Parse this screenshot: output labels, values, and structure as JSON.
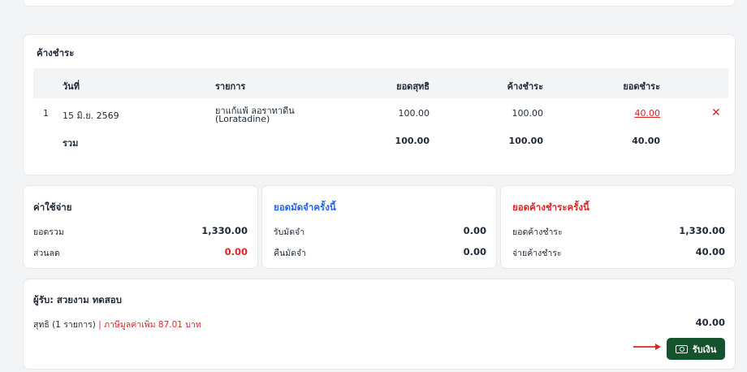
{
  "debt": {
    "title": "ค้างชำระ",
    "columns": [
      "วันที่",
      "รายการ",
      "ยอดสุทธิ",
      "ค้างชำระ",
      "ยอดชำระ"
    ],
    "rows": [
      {
        "index": "1",
        "date": "15 มิ.ย. 2569",
        "item_line1": "ยาแก้แพ้ ลอราทาดีน",
        "item_line2": "(Loratadine)",
        "net": "100.00",
        "outstanding": "100.00",
        "paid": "40.00"
      }
    ],
    "total": {
      "label": "รวม",
      "net": "100.00",
      "outstanding": "100.00",
      "paid": "40.00"
    }
  },
  "expenses": {
    "title": "ค่าใช้จ่าย",
    "rows": [
      {
        "label": "ยอดรวม",
        "value": "1,330.00"
      },
      {
        "label": "ส่วนลด",
        "value": "0.00"
      }
    ]
  },
  "deposit": {
    "title": "ยอดมัดจำครั้งนี้",
    "rows": [
      {
        "label": "รับมัดจำ",
        "value": "0.00"
      },
      {
        "label": "คืนมัดจำ",
        "value": "0.00"
      }
    ]
  },
  "outstanding_now": {
    "title": "ยอดค้างชำระครั้งนี้",
    "rows": [
      {
        "label": "ยอดค้างชำระ",
        "value": "1,330.00"
      },
      {
        "label": "จ่ายค้างชำระ",
        "value": "40.00"
      }
    ]
  },
  "receiver": {
    "title": "ผู้รับ: สวยงาม ทดสอบ",
    "net_label": "สุทธิ (1 รายการ)",
    "separator": "|",
    "vat_text": "ภาษีมูลค่าเพิ่ม 87.01 บาท",
    "net_value": "40.00",
    "pay_button": "รับเงิน"
  },
  "colors": {
    "accent_green": "#14532d",
    "danger_red": "#dc2626",
    "info_blue": "#2563eb"
  }
}
